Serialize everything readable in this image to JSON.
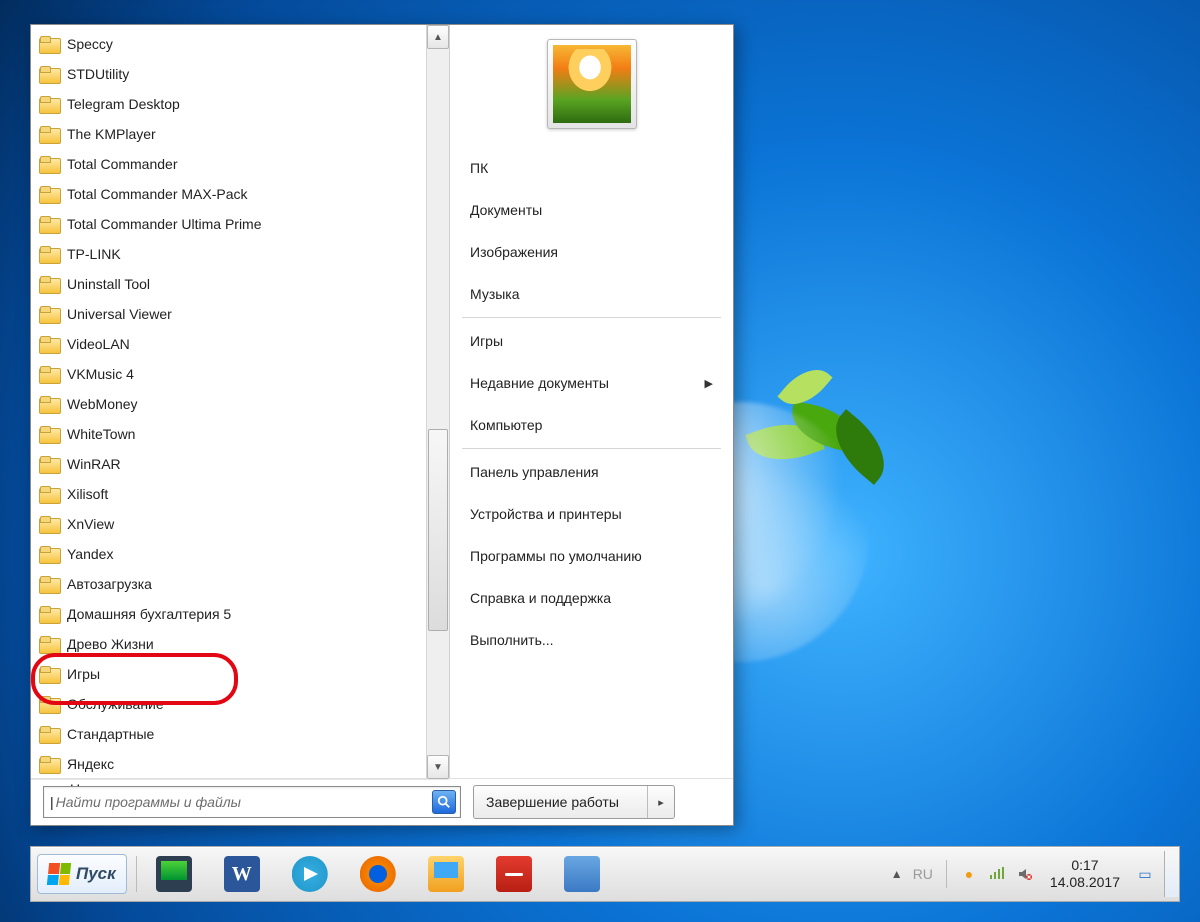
{
  "programs": [
    "Speccy",
    "STDUtility",
    "Telegram Desktop",
    "The KMPlayer",
    "Total Commander",
    "Total Commander MAX-Pack",
    "Total Commander Ultima Prime",
    "TP-LINK",
    "Uninstall Tool",
    "Universal Viewer",
    "VideoLAN",
    "VKMusic 4",
    "WebMoney",
    "WhiteTown",
    "WinRAR",
    "Xilisoft",
    "XnView",
    "Yandex",
    "Автозагрузка",
    "Домашняя бухгалтерия 5",
    "Древо Жизни",
    "Игры",
    "Обслуживание",
    "Стандартные",
    "Яндекс"
  ],
  "back_label": "Назад",
  "search": {
    "placeholder": "Найти программы и файлы"
  },
  "shutdown": {
    "label": "Завершение работы"
  },
  "right_panel": {
    "group1": [
      "ПК",
      "Документы",
      "Изображения",
      "Музыка"
    ],
    "group2": [
      {
        "label": "Игры",
        "arrow": false
      },
      {
        "label": "Недавние документы",
        "arrow": true
      },
      {
        "label": "Компьютер",
        "arrow": false
      }
    ],
    "group3": [
      "Панель управления",
      "Устройства и принтеры",
      "Программы по умолчанию",
      "Справка и поддержка",
      "Выполнить..."
    ]
  },
  "taskbar": {
    "start": "Пуск",
    "tray_lang": "RU",
    "clock_time": "0:17",
    "clock_date": "14.08.2017"
  }
}
